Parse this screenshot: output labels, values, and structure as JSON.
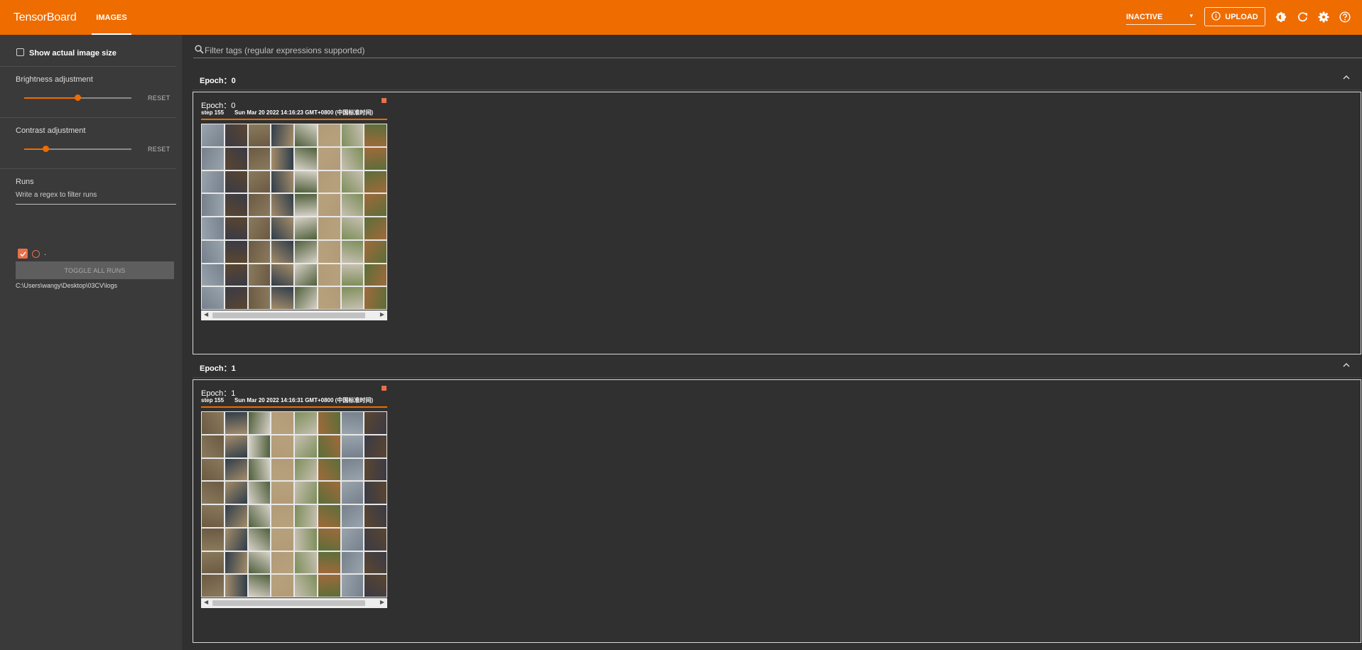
{
  "app": {
    "title": "TensorBoard",
    "tab": "IMAGES"
  },
  "header": {
    "reload_state": "INACTIVE",
    "upload_label": "UPLOAD",
    "icons": [
      "theme-icon",
      "refresh-icon",
      "settings-icon",
      "help-icon"
    ],
    "accent": "#ef6c00"
  },
  "sidebar": {
    "show_actual_size": "Show actual image size",
    "brightness": {
      "label": "Brightness adjustment",
      "reset": "RESET",
      "level": 0.5
    },
    "contrast": {
      "label": "Contrast adjustment",
      "reset": "RESET",
      "level": 0.2
    },
    "runs": {
      "title": "Runs",
      "filter_placeholder": "Write a regex to filter runs",
      "run_name": ".",
      "toggle_all": "TOGGLE ALL RUNS",
      "logdir": "C:\\Users\\wangy\\Desktop\\03CV\\logs"
    }
  },
  "filter": {
    "placeholder": "Filter tags (regular expressions supported)"
  },
  "groups": [
    {
      "header": "Epoch：0",
      "card": {
        "title": "Epoch：0",
        "step": "step 155",
        "timestamp": "Sun Mar 20 2022 14:16:23 GMT+0800 (中国标准时间)"
      }
    },
    {
      "header": "Epoch：1",
      "card": {
        "title": "Epoch：1",
        "step": "step 155",
        "timestamp": "Sun Mar 20 2022 14:16:31 GMT+0800 (中国标准时间)"
      }
    }
  ]
}
